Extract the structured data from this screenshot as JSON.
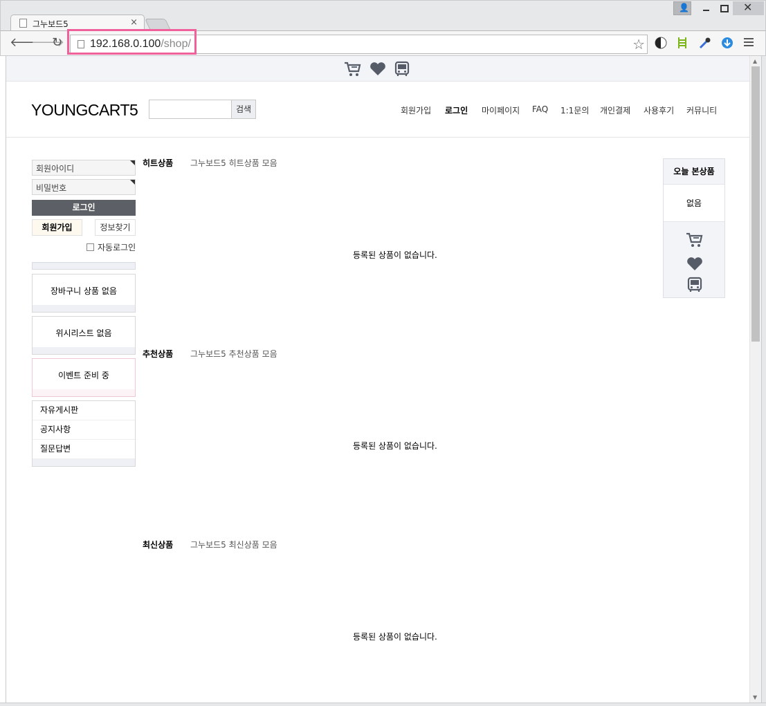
{
  "browser": {
    "tab_title": "그누보드5",
    "tab_close": "×",
    "url_host": "192.168.0.100",
    "url_path": "/shop/",
    "window_close": "✕",
    "user_glyph": "👤"
  },
  "header": {
    "logo": "YOUNGCART5",
    "search_button": "검색",
    "nav": [
      "회원가입",
      "로그인",
      "마이페이지",
      "FAQ",
      "1:1문의",
      "개인결제",
      "사용후기",
      "커뮤니티"
    ]
  },
  "sidebar": {
    "id_placeholder": "회원아이디",
    "pw_placeholder": "비밀번호",
    "login_button": "로그인",
    "join_button": "회원가입",
    "find_button": "정보찾기",
    "auto_login": "자동로그인",
    "cart_empty": "장바구니 상품 없음",
    "wish_empty": "위시리스트 없음",
    "event_empty": "이벤트 준비 중",
    "boards": [
      "자유게시판",
      "공지사항",
      "질문답변"
    ]
  },
  "sections": [
    {
      "title": "히트상품",
      "desc": "그누보드5 히트상품 모음",
      "empty": "등록된 상품이 없습니다."
    },
    {
      "title": "추천상품",
      "desc": "그누보드5 추천상품 모음",
      "empty": "등록된 상품이 없습니다."
    },
    {
      "title": "최신상품",
      "desc": "그누보드5 최신상품 모음",
      "empty": "등록된 상품이 없습니다."
    }
  ],
  "today": {
    "title": "오늘 본상품",
    "empty": "없음"
  },
  "colors": {
    "highlight": "#f0609a",
    "icon": "#555c68",
    "login_btn": "#5c6066"
  }
}
